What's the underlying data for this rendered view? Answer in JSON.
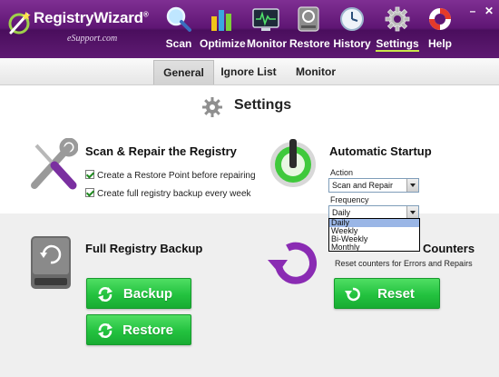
{
  "app": {
    "name": "RegistryWizard",
    "trademark": "®",
    "subtitle": "eSupport.com"
  },
  "nav": {
    "active": "Settings",
    "items": [
      {
        "label": "Scan",
        "icon": "magnifier-icon"
      },
      {
        "label": "Optimize",
        "icon": "bar-chart-icon"
      },
      {
        "label": "Monitor",
        "icon": "monitor-icon"
      },
      {
        "label": "Restore",
        "icon": "drive-restore-icon"
      },
      {
        "label": "History",
        "icon": "clock-icon"
      },
      {
        "label": "Settings",
        "icon": "gear-icon"
      },
      {
        "label": "Help",
        "icon": "lifebuoy-icon"
      }
    ]
  },
  "window_controls": {
    "minimize": "–",
    "close": "✕"
  },
  "subtabs": {
    "active": "General",
    "items": [
      "General",
      "Ignore List",
      "Monitor"
    ]
  },
  "page_title": "Settings",
  "scan_repair": {
    "title": "Scan & Repair the Registry",
    "options": [
      {
        "label": "Create a Restore Point before repairing",
        "checked": true
      },
      {
        "label": "Create full registry backup every week",
        "checked": true
      }
    ]
  },
  "startup": {
    "title": "Automatic Startup",
    "action_label": "Action",
    "action_value": "Scan and Repair",
    "frequency_label": "Frequency",
    "frequency_value": "Daily",
    "frequency_options": [
      "Daily",
      "Weekly",
      "Bi-Weekly",
      "Monthly"
    ],
    "frequency_selected_index": 0
  },
  "backup": {
    "title": "Full Registry Backup",
    "backup_label": "Backup",
    "restore_label": "Restore"
  },
  "counters": {
    "title_visible": "Counters",
    "description": "Reset counters for Errors and Repairs",
    "reset_label": "Reset"
  },
  "colors": {
    "header": "#5f1674",
    "accent_green": "#23c23f",
    "active_underline": "#c9e64a",
    "reset_icon": "#8a2bb3"
  }
}
